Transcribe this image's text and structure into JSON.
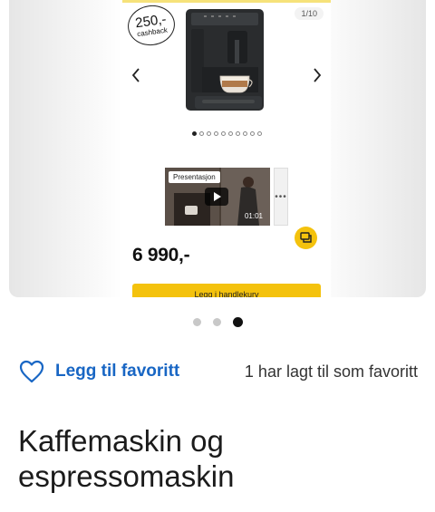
{
  "carousel": {
    "counter": "1/10",
    "cashback": {
      "amount": "250,-",
      "label": "cashback"
    },
    "image_dots": {
      "total": 10,
      "active_index": 0
    },
    "video": {
      "badge": "Presentasjon",
      "duration": "01:01"
    },
    "more_icon": "ellipsis-icon",
    "chat_icon": "chat-icon",
    "price": "6 990,-",
    "add_to_cart": "Legg i handlekurv"
  },
  "pager": {
    "total": 3,
    "active_index": 2
  },
  "favorite": {
    "label": "Legg til favoritt",
    "count_text": "1 har lagt til som favoritt",
    "icon": "heart-icon"
  },
  "product": {
    "title": "Kaffemaskin og espressomaskin"
  },
  "colors": {
    "accent_yellow": "#f4c20d",
    "link_blue": "#1866c4"
  }
}
